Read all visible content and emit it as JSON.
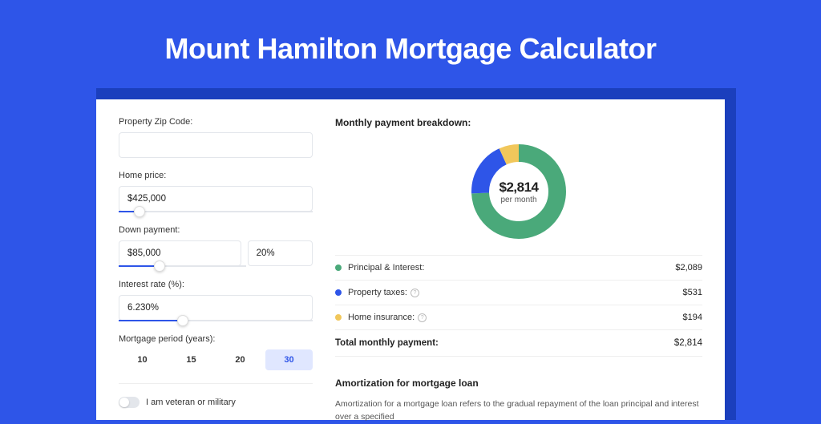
{
  "title": "Mount Hamilton Mortgage Calculator",
  "form": {
    "zip_label": "Property Zip Code:",
    "zip_value": "",
    "home_price_label": "Home price:",
    "home_price_value": "$425,000",
    "down_payment_label": "Down payment:",
    "down_payment_value": "$85,000",
    "down_payment_pct": "20%",
    "interest_label": "Interest rate (%):",
    "interest_value": "6.230%",
    "period_label": "Mortgage period (years):",
    "periods": [
      "10",
      "15",
      "20",
      "30"
    ],
    "period_active": 3,
    "toggle_label": "I am veteran or military",
    "slider_positions": {
      "home_price": 8,
      "down_payment": 28,
      "interest": 30
    }
  },
  "breakdown": {
    "title": "Monthly payment breakdown:",
    "donut_value": "$2,814",
    "donut_sub": "per month",
    "items": [
      {
        "label": "Principal & Interest:",
        "value": "$2,089",
        "color": "green",
        "info": false
      },
      {
        "label": "Property taxes:",
        "value": "$531",
        "color": "blue",
        "info": true
      },
      {
        "label": "Home insurance:",
        "value": "$194",
        "color": "yellow",
        "info": true
      }
    ],
    "total_label": "Total monthly payment:",
    "total_value": "$2,814"
  },
  "amortization": {
    "title": "Amortization for mortgage loan",
    "body": "Amortization for a mortgage loan refers to the gradual repayment of the loan principal and interest over a specified"
  },
  "chart_data": {
    "type": "pie",
    "title": "Monthly payment breakdown",
    "series": [
      {
        "name": "Principal & Interest",
        "value": 2089,
        "color": "#4aa97a"
      },
      {
        "name": "Property taxes",
        "value": 531,
        "color": "#2e55e8"
      },
      {
        "name": "Home insurance",
        "value": 194,
        "color": "#f1c75b"
      }
    ],
    "total": 2814
  }
}
